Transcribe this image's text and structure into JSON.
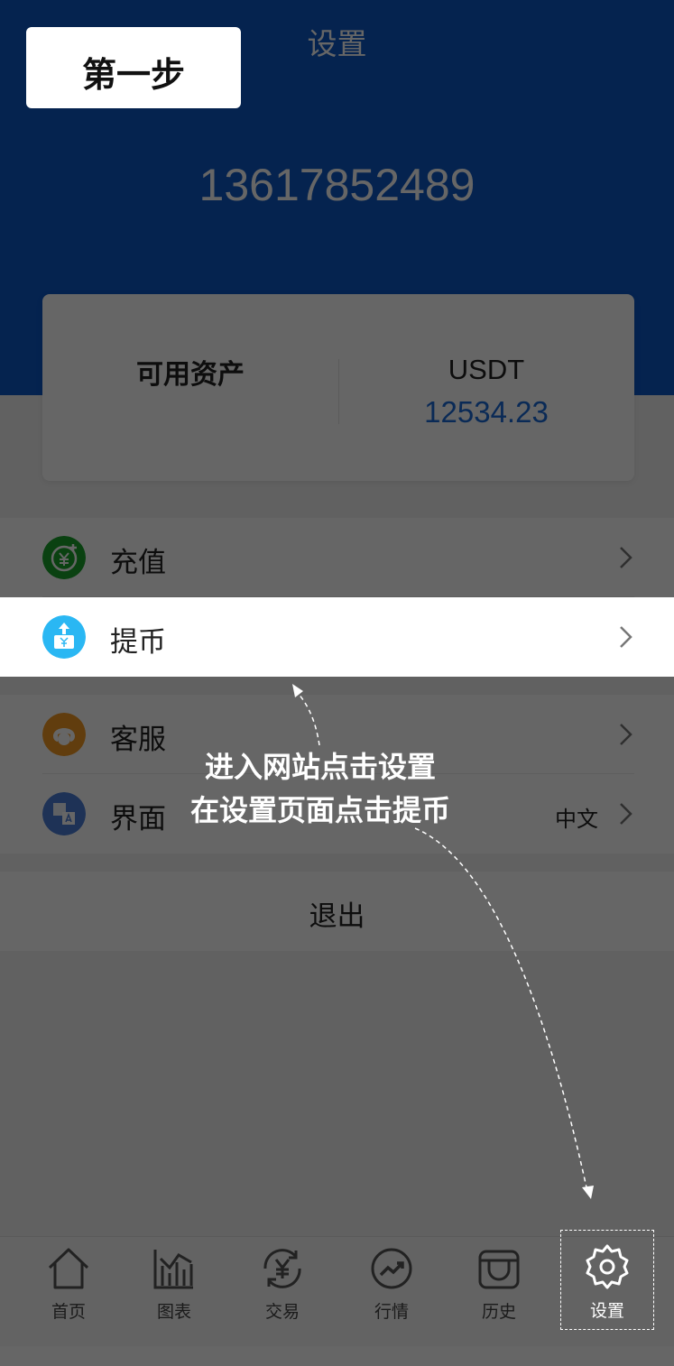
{
  "header": {
    "title": "设置",
    "account": "13617852489"
  },
  "asset_card": {
    "label": "可用资产",
    "currency": "USDT",
    "amount": "12534.23"
  },
  "menu": {
    "items": [
      {
        "label": "充值",
        "icon": "recharge-icon",
        "color": "#1aa32c"
      },
      {
        "label": "提币",
        "icon": "withdraw-icon",
        "color": "#2ab7f3"
      },
      {
        "label": "客服",
        "icon": "customer-service-icon",
        "color": "#f29a25"
      },
      {
        "label": "界面",
        "icon": "language-icon",
        "color": "#4b7dd8",
        "value": "中文"
      }
    ],
    "logout": "退出"
  },
  "tabbar": {
    "items": [
      {
        "label": "首页",
        "icon": "home-icon"
      },
      {
        "label": "图表",
        "icon": "chart-icon"
      },
      {
        "label": "交易",
        "icon": "trade-icon"
      },
      {
        "label": "行情",
        "icon": "market-icon"
      },
      {
        "label": "历史",
        "icon": "history-icon"
      },
      {
        "label": "设置",
        "icon": "settings-icon"
      }
    ]
  },
  "overlay": {
    "step": "第一步",
    "instruction_line1": "进入网站点击设置",
    "instruction_line2": "在设置页面点击提币"
  },
  "colors": {
    "header_blue": "#0d57c6",
    "amount_blue": "#1b6ad8"
  }
}
